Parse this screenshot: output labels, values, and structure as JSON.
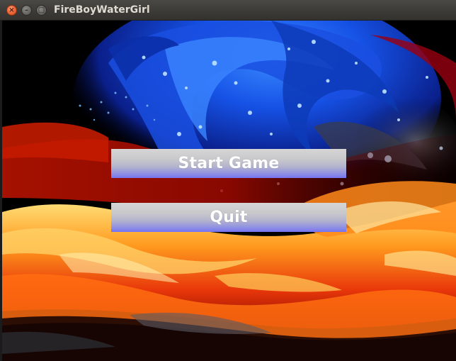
{
  "window": {
    "title": "FireBoyWaterGirl",
    "close_glyph": "×",
    "minimize_glyph": "–",
    "maximize_glyph": "□"
  },
  "menu": {
    "start_label": "Start Game",
    "quit_label": "Quit"
  },
  "theme": {
    "button_gradient_top": "#d6d6d6",
    "button_gradient_bottom": "#7474f2",
    "button_text": "#ffffff",
    "background_water": "#1a4fe0",
    "background_fire": "#ff6a10"
  },
  "icons": {
    "close": "close-icon",
    "minimize": "minimize-icon",
    "maximize": "maximize-icon"
  }
}
